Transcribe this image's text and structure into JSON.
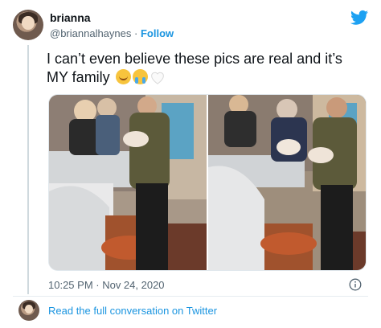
{
  "user": {
    "name": "brianna",
    "handle": "@briannalhaynes",
    "separator": "·",
    "follow_label": "Follow"
  },
  "tweet": {
    "text": "I can’t even believe these pics are real and it’s MY family",
    "emojis": [
      "star-struck-emoji",
      "crying-emoji",
      "white-heart-emoji"
    ]
  },
  "timestamp": "10:25 PM · Nov 24, 2020",
  "footer": {
    "read_more_label": "Read the full conversation on Twitter"
  },
  "colors": {
    "link_blue": "#1b95e0",
    "muted_text": "#536471",
    "twitter_bird": "#1da1f2"
  }
}
